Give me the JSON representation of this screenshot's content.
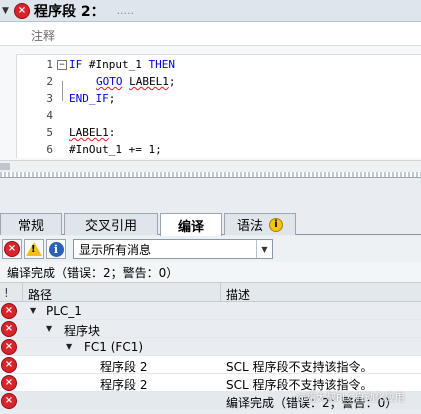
{
  "network": {
    "title": "程序段 2：",
    "placeholder_dots": ".....",
    "comment_label": "注释"
  },
  "code": [
    {
      "num": "1",
      "text": "IF #Input_1 THEN"
    },
    {
      "num": "2",
      "text": "GOTO LABEL1;"
    },
    {
      "num": "3",
      "text": "END_IF;"
    },
    {
      "num": "4",
      "text": ""
    },
    {
      "num": "5",
      "text": "LABEL1:"
    },
    {
      "num": "6",
      "text": "#InOut_1 += 1;"
    }
  ],
  "code_parts": {
    "if_kw": "IF",
    "if_var": " #Input_1 ",
    "then_kw": "THEN",
    "goto_kw": "GOTO",
    "goto_sp": " ",
    "goto_label": "LABEL1",
    "goto_end": ";",
    "endif_kw": "END_IF",
    "endif_end": ";",
    "label_name": "LABEL1",
    "label_colon": ":",
    "line6": "#InOut_1 += 1;"
  },
  "tabs": [
    {
      "label": "常规"
    },
    {
      "label": "交叉引用"
    },
    {
      "label": "编译",
      "active": true
    },
    {
      "label": "语法"
    }
  ],
  "icons": {
    "error": "×",
    "warning": "!",
    "info": "i",
    "syntax_info": "i"
  },
  "filter": {
    "selected": "显示所有消息"
  },
  "summary": "编译完成（错误：2；警告：0）",
  "grid": {
    "col_marker": "!",
    "col_path": "路径",
    "col_desc": "描述"
  },
  "rows": [
    {
      "level": 0,
      "path": "PLC_1",
      "desc": "",
      "expand": true
    },
    {
      "level": 1,
      "path": "程序块",
      "desc": "",
      "expand": true
    },
    {
      "level": 2,
      "path": "FC1 (FC1)",
      "desc": "",
      "expand": true
    },
    {
      "level": 3,
      "path": "程序段 2",
      "desc": "SCL 程序段不支持该指令。",
      "expand": false
    },
    {
      "level": 3,
      "path": "程序段 2",
      "desc": "SCL 程序段不支持该指令。",
      "expand": false
    },
    {
      "level": 3,
      "path": "",
      "desc": "编译完成（错误：2；警告：0）",
      "expand": false
    }
  ],
  "watermark": "@嗨大叔PLC自动化应用",
  "colors": {
    "error_red": "#d9242b",
    "warning_yellow": "#f4c00d",
    "info_blue": "#2b5fb8",
    "keyword_blue": "#0000e0"
  }
}
